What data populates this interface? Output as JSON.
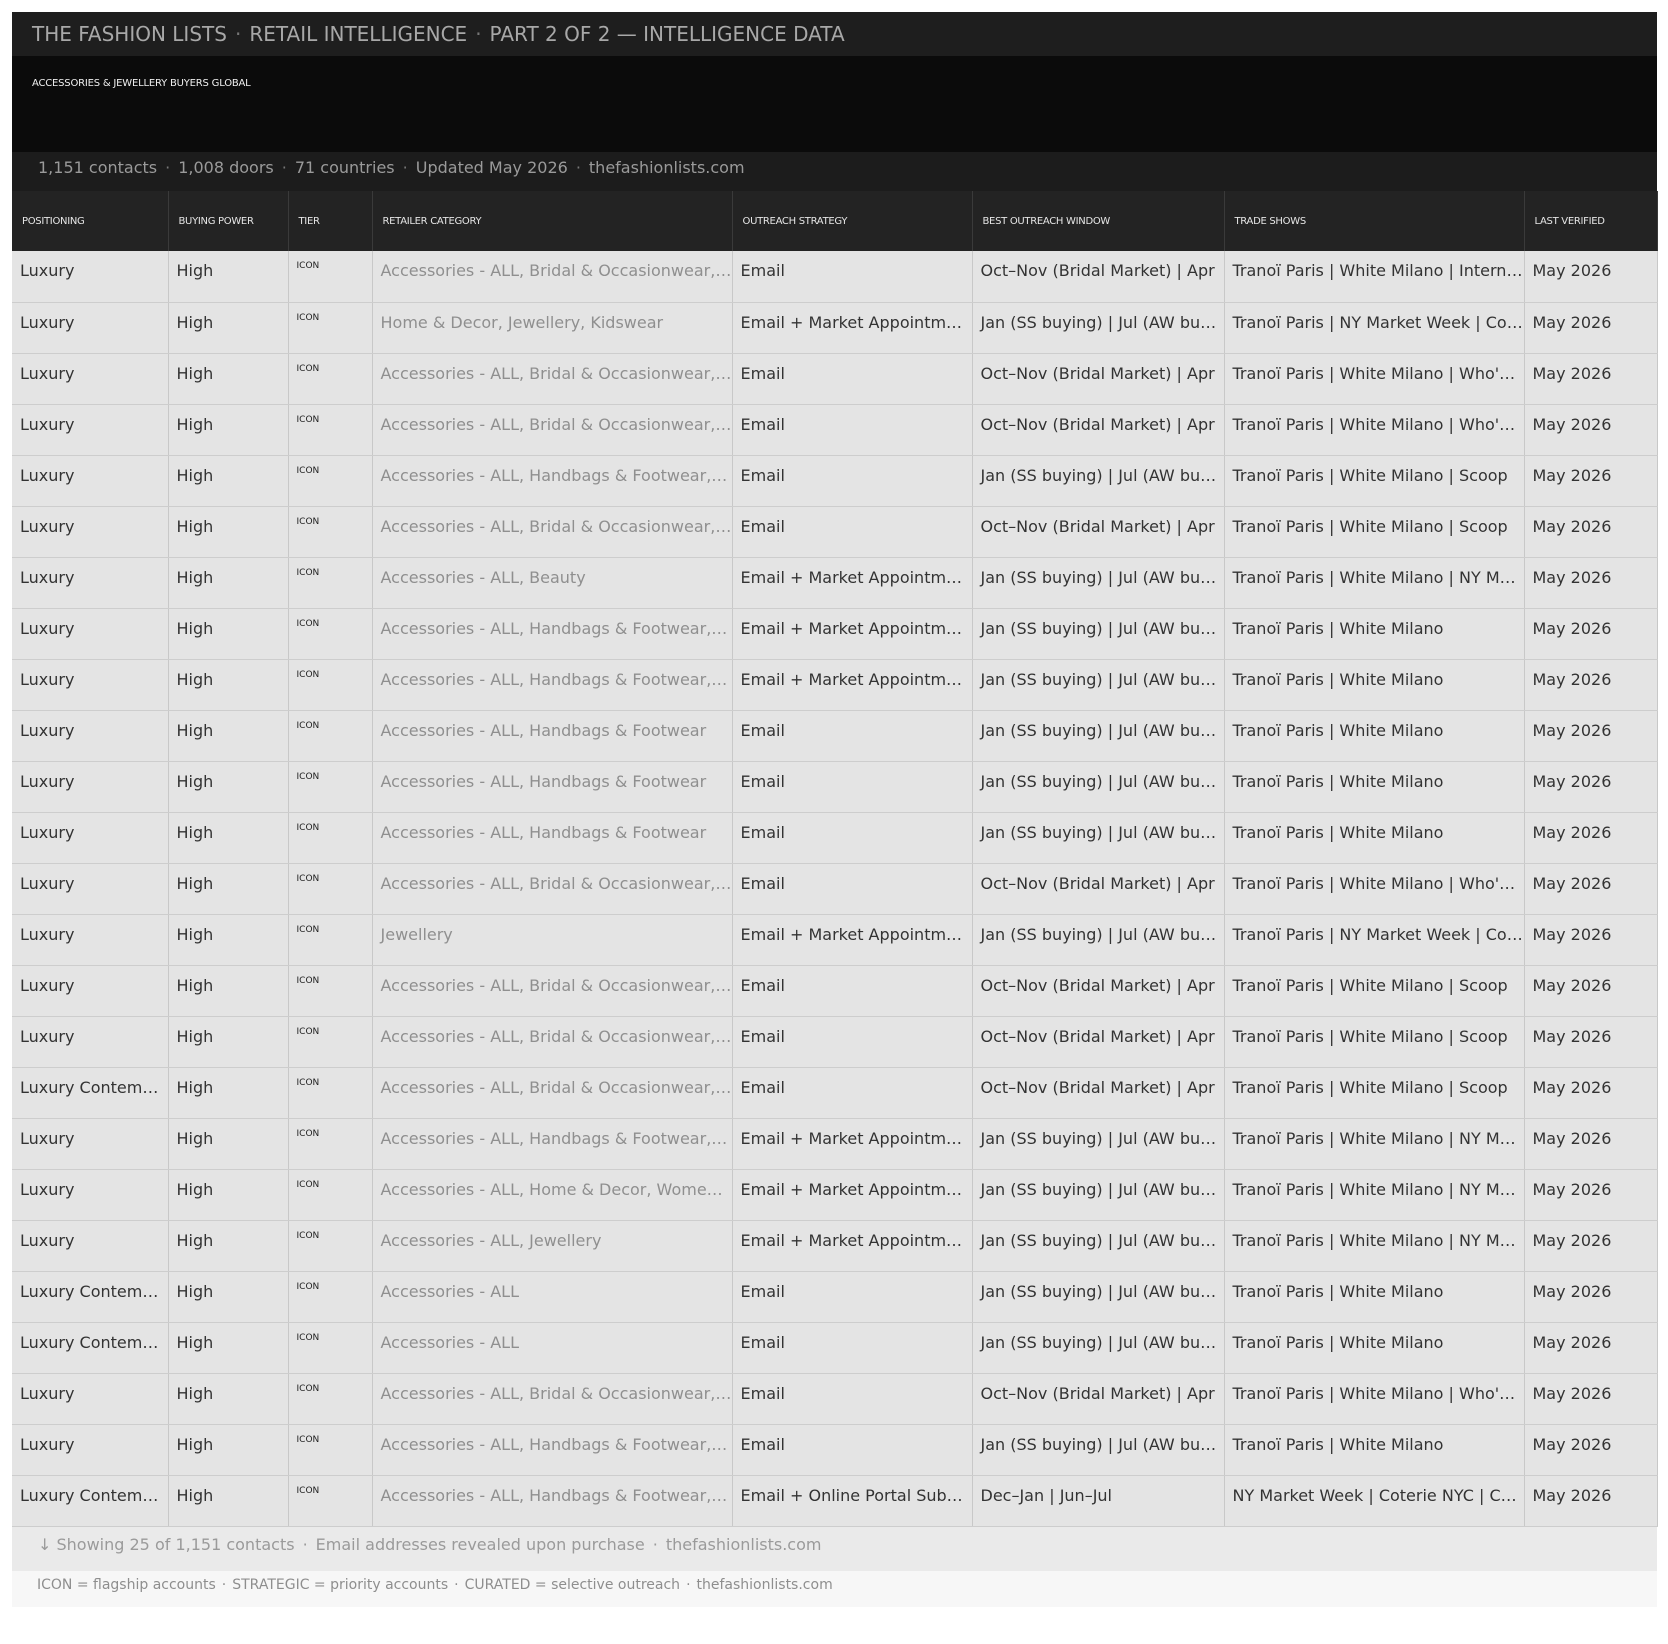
{
  "header": {
    "brand": "THE FASHION LISTS",
    "section": "RETAIL INTELLIGENCE",
    "part": "PART 2 OF 2 — INTELLIGENCE DATA",
    "separator": "·"
  },
  "hero": {
    "subtitle": "ACCESSORIES & JEWELLERY BUYERS GLOBAL"
  },
  "stats": {
    "contacts": "1,151 contacts",
    "doors": "1,008 doors",
    "countries": "71 countries",
    "updated": "Updated May 2026",
    "site": "thefashionlists.com"
  },
  "columns": [
    "POSITIONING",
    "BUYING POWER",
    "TIER",
    "RETAILER CATEGORY",
    "OUTREACH STRATEGY",
    "BEST OUTREACH WINDOW",
    "TRADE SHOWS",
    "LAST VERIFIED"
  ],
  "rows": [
    [
      "Luxury",
      "High",
      "ICON",
      "Accessories - ALL, Bridal & Occasionwear, Jewellery",
      "Email",
      "Oct–Nov (Bridal Market) | Apr",
      "Tranoï Paris | White Milano | International",
      "May 2026"
    ],
    [
      "Luxury",
      "High",
      "ICON",
      "Home & Decor, Jewellery, Kidswear",
      "Email + Market Appointments",
      "Jan (SS buying) | Jul (AW buying)",
      "Tranoï Paris | NY Market Week | Coterie",
      "May 2026"
    ],
    [
      "Luxury",
      "High",
      "ICON",
      "Accessories - ALL, Bridal & Occasionwear, Jewellery",
      "Email",
      "Oct–Nov (Bridal Market) | Apr",
      "Tranoï Paris | White Milano | Who's Next",
      "May 2026"
    ],
    [
      "Luxury",
      "High",
      "ICON",
      "Accessories - ALL, Bridal & Occasionwear, Jewellery",
      "Email",
      "Oct–Nov (Bridal Market) | Apr",
      "Tranoï Paris | White Milano | Who's Next",
      "May 2026"
    ],
    [
      "Luxury",
      "High",
      "ICON",
      "Accessories - ALL, Handbags & Footwear, Jewellery",
      "Email",
      "Jan (SS buying) | Jul (AW buying)",
      "Tranoï Paris | White Milano | Scoop",
      "May 2026"
    ],
    [
      "Luxury",
      "High",
      "ICON",
      "Accessories - ALL, Bridal & Occasionwear, Jewellery",
      "Email",
      "Oct–Nov (Bridal Market) | Apr",
      "Tranoï Paris | White Milano | Scoop",
      "May 2026"
    ],
    [
      "Luxury",
      "High",
      "ICON",
      "Accessories - ALL, Beauty",
      "Email + Market Appointments",
      "Jan (SS buying) | Jul (AW buying)",
      "Tranoï Paris | White Milano | NY Market Week",
      "May 2026"
    ],
    [
      "Luxury",
      "High",
      "ICON",
      "Accessories - ALL, Handbags & Footwear, Jewellery",
      "Email + Market Appointments",
      "Jan (SS buying) | Jul (AW buying)",
      "Tranoï Paris | White Milano",
      "May 2026"
    ],
    [
      "Luxury",
      "High",
      "ICON",
      "Accessories - ALL, Handbags & Footwear, Jewellery",
      "Email + Market Appointments",
      "Jan (SS buying) | Jul (AW buying)",
      "Tranoï Paris | White Milano",
      "May 2026"
    ],
    [
      "Luxury",
      "High",
      "ICON",
      "Accessories - ALL, Handbags & Footwear",
      "Email",
      "Jan (SS buying) | Jul (AW buying)",
      "Tranoï Paris | White Milano",
      "May 2026"
    ],
    [
      "Luxury",
      "High",
      "ICON",
      "Accessories - ALL, Handbags & Footwear",
      "Email",
      "Jan (SS buying) | Jul (AW buying)",
      "Tranoï Paris | White Milano",
      "May 2026"
    ],
    [
      "Luxury",
      "High",
      "ICON",
      "Accessories - ALL, Handbags & Footwear",
      "Email",
      "Jan (SS buying) | Jul (AW buying)",
      "Tranoï Paris | White Milano",
      "May 2026"
    ],
    [
      "Luxury",
      "High",
      "ICON",
      "Accessories - ALL, Bridal & Occasionwear, Jewellery",
      "Email",
      "Oct–Nov (Bridal Market) | Apr",
      "Tranoï Paris | White Milano | Who's Next",
      "May 2026"
    ],
    [
      "Luxury",
      "High",
      "ICON",
      "Jewellery",
      "Email + Market Appointments",
      "Jan (SS buying) | Jul (AW buying)",
      "Tranoï Paris | NY Market Week | Coterie",
      "May 2026"
    ],
    [
      "Luxury",
      "High",
      "ICON",
      "Accessories - ALL, Bridal & Occasionwear, Jewellery",
      "Email",
      "Oct–Nov (Bridal Market) | Apr",
      "Tranoï Paris | White Milano | Scoop",
      "May 2026"
    ],
    [
      "Luxury",
      "High",
      "ICON",
      "Accessories - ALL, Bridal & Occasionwear, Jewellery",
      "Email",
      "Oct–Nov (Bridal Market) | Apr",
      "Tranoï Paris | White Milano | Scoop",
      "May 2026"
    ],
    [
      "Luxury Contemporary",
      "High",
      "ICON",
      "Accessories - ALL, Bridal & Occasionwear, Jewellery",
      "Email",
      "Oct–Nov (Bridal Market) | Apr",
      "Tranoï Paris | White Milano | Scoop",
      "May 2026"
    ],
    [
      "Luxury",
      "High",
      "ICON",
      "Accessories - ALL, Handbags & Footwear, Jewellery",
      "Email + Market Appointments",
      "Jan (SS buying) | Jul (AW buying)",
      "Tranoï Paris | White Milano | NY Market Week",
      "May 2026"
    ],
    [
      "Luxury",
      "High",
      "ICON",
      "Accessories - ALL, Home & Decor, Womenswear",
      "Email + Market Appointments",
      "Jan (SS buying) | Jul (AW buying)",
      "Tranoï Paris | White Milano | NY Market Week",
      "May 2026"
    ],
    [
      "Luxury",
      "High",
      "ICON",
      "Accessories - ALL, Jewellery",
      "Email + Market Appointments",
      "Jan (SS buying) | Jul (AW buying)",
      "Tranoï Paris | White Milano | NY Market Week",
      "May 2026"
    ],
    [
      "Luxury Contemporary",
      "High",
      "ICON",
      "Accessories - ALL",
      "Email",
      "Jan (SS buying) | Jul (AW buying)",
      "Tranoï Paris | White Milano",
      "May 2026"
    ],
    [
      "Luxury Contemporary",
      "High",
      "ICON",
      "Accessories - ALL",
      "Email",
      "Jan (SS buying) | Jul (AW buying)",
      "Tranoï Paris | White Milano",
      "May 2026"
    ],
    [
      "Luxury",
      "High",
      "ICON",
      "Accessories - ALL, Bridal & Occasionwear, Jewellery",
      "Email",
      "Oct–Nov (Bridal Market) | Apr",
      "Tranoï Paris | White Milano | Who's Next",
      "May 2026"
    ],
    [
      "Luxury",
      "High",
      "ICON",
      "Accessories - ALL, Handbags & Footwear, Jewellery",
      "Email",
      "Jan (SS buying) | Jul (AW buying)",
      "Tranoï Paris | White Milano",
      "May 2026"
    ],
    [
      "Luxury Contemporary",
      "High",
      "ICON",
      "Accessories - ALL, Handbags & Footwear, Jewellery",
      "Email + Online Portal Submission",
      "Dec–Jan | Jun–Jul",
      "NY Market Week | Coterie NYC | Capsule",
      "May 2026"
    ]
  ],
  "footer": {
    "arrow": "↓",
    "showing": "Showing 25 of 1,151 contacts",
    "reveal": "Email addresses revealed upon purchase",
    "site": "thefashionlists.com"
  },
  "legend": {
    "icon": "ICON = flagship accounts",
    "strategic": "STRATEGIC = priority accounts",
    "curated": "CURATED = selective outreach",
    "site": "thefashionlists.com"
  }
}
